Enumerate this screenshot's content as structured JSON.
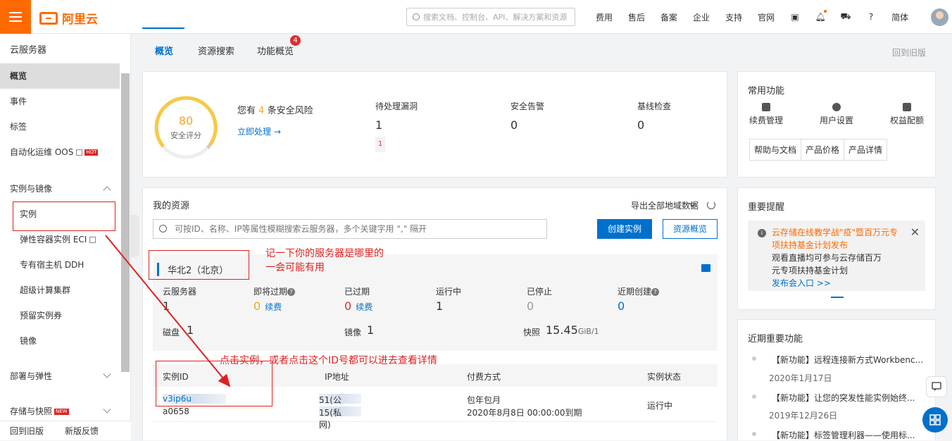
{
  "header": {
    "logo_text": "阿里云",
    "search_placeholder": "搜索文档、控制台、API、解决方案和资源",
    "nav": [
      "费用",
      "售后",
      "备案",
      "企业",
      "支持",
      "官网"
    ],
    "lang": "简体"
  },
  "sidebar": {
    "title": "云服务器",
    "items": [
      "概览",
      "事件",
      "标签",
      "自动化运维 OOS"
    ],
    "hot_badge": "HOT",
    "new_badge": "NEW",
    "group1": "实例与镜像",
    "sub_items": [
      "实例",
      "弹性容器实例 ECI",
      "专有宿主机 DDH",
      "超级计算集群",
      "预留实例券",
      "镜像"
    ],
    "group2": "部署与弹性",
    "group3": "存储与快照",
    "footer_back": "回到旧版",
    "footer_feedback": "新版反馈"
  },
  "tabs": {
    "items": [
      "概览",
      "资源搜索",
      "功能概览"
    ],
    "badge": "4",
    "back_old": "回到旧版"
  },
  "security": {
    "score": "80",
    "score_label": "安全评分",
    "risk_prefix": "您有",
    "risk_count": "4",
    "risk_suffix": "条安全风险",
    "fix_link": "立即处理 →",
    "vuln_label": "待处理漏洞",
    "vuln_value": "1",
    "vuln_tag": "1",
    "alert_label": "安全告警",
    "alert_value": "0",
    "baseline_label": "基线检查",
    "baseline_value": "0"
  },
  "common_functions": {
    "title": "常用功能",
    "items": [
      "续费管理",
      "用户设置",
      "权益配额"
    ],
    "buttons": [
      "帮助与文档",
      "产品价格",
      "产品详情"
    ]
  },
  "resources": {
    "title": "我的资源",
    "export": "导出全部地域数据",
    "search_placeholder": "可按ID、名称、IP等属性模糊搜索云服务器，多个关键字用 \",\" 隔开",
    "create_btn": "创建实例",
    "overview_btn": "资源概览",
    "region": "华北2（北京）",
    "stats": [
      {
        "label": "云服务器",
        "value": "1"
      },
      {
        "label": "即将过期",
        "value": "0",
        "link": "续费"
      },
      {
        "label": "已过期",
        "value": "0",
        "link": "续费"
      },
      {
        "label": "运行中",
        "value": "1"
      },
      {
        "label": "已停止",
        "value": "0"
      },
      {
        "label": "近期创建",
        "value": "0"
      }
    ],
    "disk_label": "磁盘",
    "disk_value": "1",
    "image_label": "镜像",
    "image_value": "1",
    "snapshot_label": "快照",
    "snapshot_value": "15.45",
    "snapshot_unit": "GiB/1",
    "table_headers": [
      "实例ID",
      "IP地址",
      "付费方式",
      "实例状态"
    ],
    "row": {
      "id_suffix": "v3ip6u",
      "id_line2": "a0658",
      "ip1": "51(公网)",
      "ip2": "15(私网)",
      "billing1": "包年包月",
      "billing2": "2020年8月8日 00:00:00到期",
      "status": "运行中"
    }
  },
  "annotations": {
    "note1_line1": "记一下你的服务器是哪里的",
    "note1_line2": "一会可能有用",
    "note2": "点击实例，或者点击这个ID号都可以进去查看详情"
  },
  "reminder": {
    "title": "重要提醒",
    "headline1": "云存储在线教学战\"疫\"暨百万元专",
    "headline2": "项扶持基金计划发布",
    "body1": "观看直播均可参与云存储百万",
    "body2": "元专项扶持基金计划",
    "link": "发布会入口 >>"
  },
  "recent": {
    "title": "近期重要功能",
    "items": [
      {
        "text": "【新功能】远程连接新方式Workbenc...",
        "date": "2020年1月17日"
      },
      {
        "text": "【新功能】让您的突发性能实例始终...",
        "date": "2019年12月26日"
      },
      {
        "text": "【新功能】标签管理利器——使用标...",
        "date": ""
      }
    ]
  }
}
